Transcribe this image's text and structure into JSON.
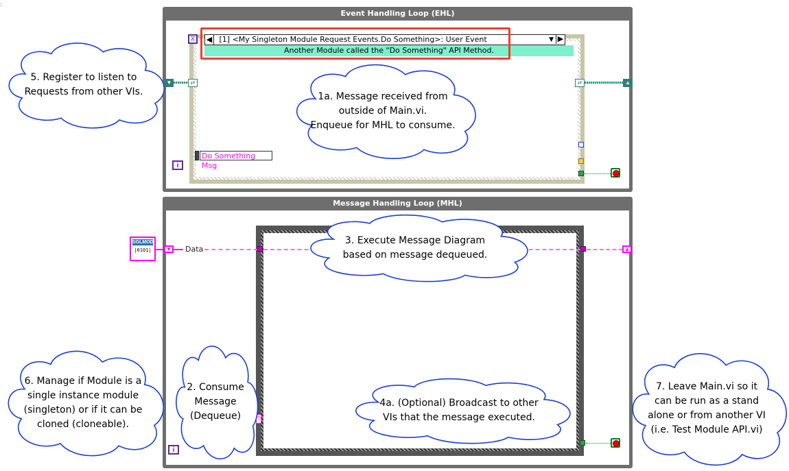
{
  "ehl": {
    "title": "Event Handling Loop (EHL)",
    "event_selector": "[1] <My Singleton Module Request Events.Do Something>: User Event",
    "event_banner": "Another Module called the \"Do Something\" API Method.",
    "constant_label": "Do Something Msg",
    "iteration_label": "i"
  },
  "mhl": {
    "title": "Message Handling Loop (MHL)",
    "data_label": "Data",
    "module_icon_label": "SGLMOD",
    "module_icon_bits": "|0101|",
    "iteration_label": "i"
  },
  "callouts": {
    "c5": "5. Register to listen to\nRequests from other VIs.",
    "c1a": "1a. Message received from\noutside of Main.vi.\nEnqueue for MHL to consume.",
    "c3": "3. Execute Message Diagram\nbased on message dequeued.",
    "c6": "6. Manage if Module is a\nsingle instance module\n(singleton) or if it can be\ncloned (cloneable).",
    "c2": "2. Consume\nMessage\n(Dequeue)",
    "c4a": "4a. (Optional) Broadcast to other\nVIs that the message executed.",
    "c7": "7. Leave Main.vi so it\ncan be run as a stand\nalone or from another VI\n(i.e. Test Module API.vi)"
  },
  "colors": {
    "callout_border": "#1a3fd6",
    "highlight": "#e8432d",
    "banner": "#7ff0cc",
    "wire_class": "#ff00ff",
    "wire_reference": "#3a8f86"
  }
}
